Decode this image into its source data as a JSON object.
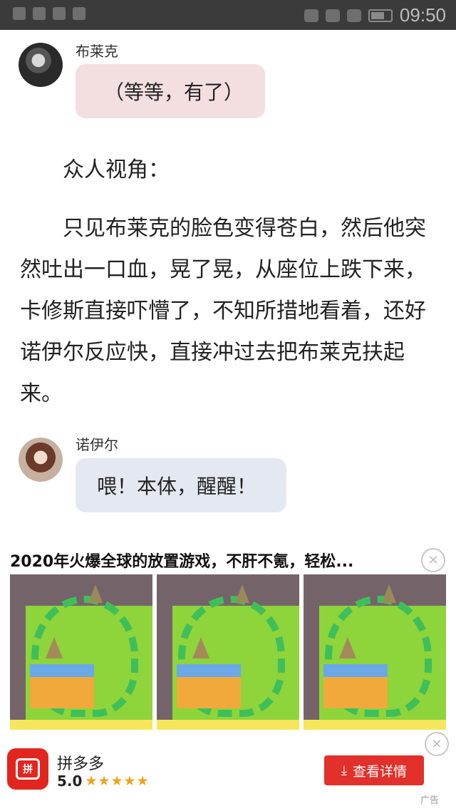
{
  "status_bar": {
    "time": "09:50",
    "icons": [
      "notification-icon",
      "close-notif-icon",
      "grid-icon",
      "message-icon",
      "alarm-icon",
      "wifi-icon",
      "signal-icon",
      "battery-icon"
    ]
  },
  "chat": {
    "message1": {
      "speaker": "布莱克",
      "text": "（等等，有了）"
    },
    "message2": {
      "speaker": "诺伊尔",
      "text": "喂！本体，醒醒！"
    }
  },
  "narration": {
    "line1": "众人视角：",
    "paragraph": "只见布莱克的脸色变得苍白，然后他突然吐出一口血，晃了晃，从座位上跌下来，卡修斯直接吓懵了，不知所措地看着，还好诺伊尔反应快，直接冲过去把布莱克扶起来。"
  },
  "ad": {
    "title": "2020年火爆全球的放置游戏，不肝不氪，轻松...",
    "close_symbol": "✕",
    "images": [
      "game-screenshot",
      "game-screenshot",
      "game-screenshot"
    ],
    "app_icon_text": "拼",
    "app_name": "拼多多",
    "rating": "5.0",
    "stars": "★★★★★",
    "cta_label": "查看详情",
    "cta_icon": "⤓",
    "tag": "广告",
    "colors": {
      "cta": "#e2302b",
      "app_icon": "#e2261f",
      "stars": "#f2a21a"
    }
  }
}
